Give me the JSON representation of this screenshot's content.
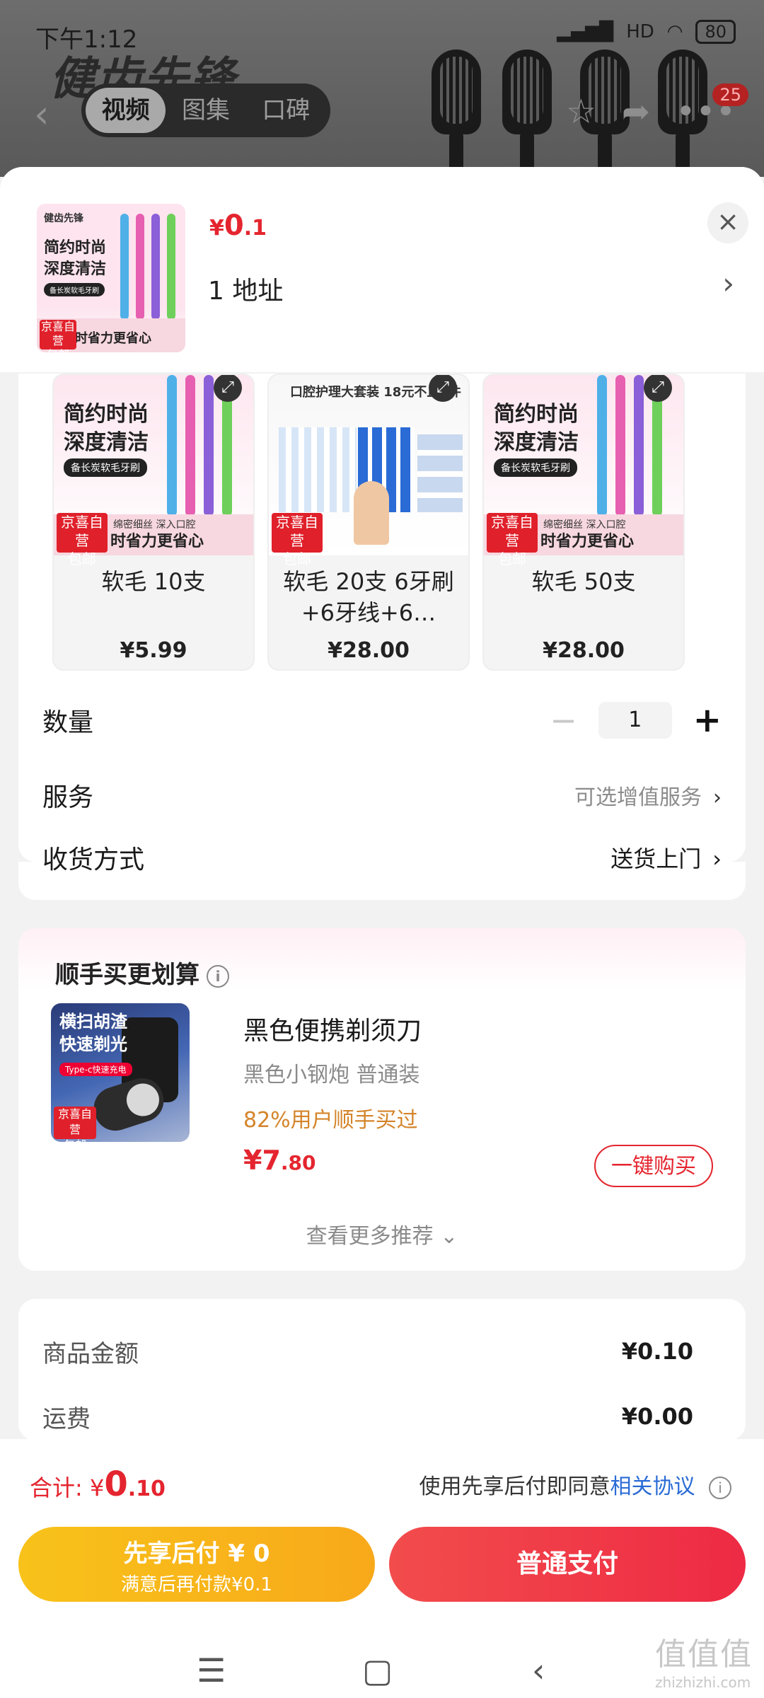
{
  "status_bar": {
    "time": "下午1:12",
    "battery": "80",
    "signal": "HD"
  },
  "top": {
    "brand": "健齿先锋",
    "tabs": [
      {
        "label": "视频",
        "active": true
      },
      {
        "label": "图集",
        "active": false
      },
      {
        "label": "口碑",
        "active": false
      }
    ],
    "cart_count": "25"
  },
  "sheet": {
    "price": {
      "symbol": "¥",
      "int": "0",
      "dec": ".1"
    },
    "address": "1  地址",
    "thumb": {
      "brand": "健齿先锋",
      "line1": "简约时尚",
      "line2": "深度清洁",
      "pill": "备长炭软毛牙刷",
      "badge": "京喜自营",
      "badge2": "包邮",
      "foot_small": "绵密细丝  深入口腔",
      "foot": "时省力更省心"
    }
  },
  "variants": [
    {
      "name": "软毛 10支",
      "price": "¥5.99",
      "line1": "简约时尚",
      "line2": "深度清洁",
      "pill": "备长炭软毛牙刷",
      "foot": "时省力更省心",
      "small": "绵密细丝  深入口腔"
    },
    {
      "name": "软毛 20支 6牙刷+6牙线+6…",
      "price": "¥28.00",
      "top": "口腔护理大套装   18元不止4件"
    },
    {
      "name": "软毛 50支",
      "price": "¥28.00",
      "line1": "简约时尚",
      "line2": "深度清洁",
      "pill": "备长炭软毛牙刷",
      "foot": "时省力更省心",
      "small": "绵密细丝  深入口腔"
    }
  ],
  "rows": {
    "quantity_label": "数量",
    "quantity_value": "1",
    "service_label": "服务",
    "service_value": "可选增值服务",
    "delivery_label": "收货方式",
    "delivery_value": "送货上门"
  },
  "recommend": {
    "title": "顺手买更划算",
    "img_text": "横扫胡渣\n快速剃光",
    "img_small": "Type-c快速充电",
    "name": "黑色便携剃须刀",
    "spec": "黑色小钢炮 普通装",
    "rate": "82%用户顺手买过",
    "price_int": "7",
    "price_dec": ".80",
    "buy": "一键购买",
    "more": "查看更多推荐"
  },
  "summary": [
    {
      "label": "商品金额",
      "value": "¥0.10"
    },
    {
      "label": "运费",
      "value": "¥0.00"
    }
  ],
  "bottom": {
    "total_label": "合计:",
    "total_int": "0",
    "total_dec": ".10",
    "agree_text": "使用先享后付即同意",
    "agree_link": "相关协议",
    "later_l1": "先享后付 ¥ 0",
    "later_l2": "满意后再付款¥0.1",
    "pay": "普通支付"
  },
  "watermark": {
    "big": "值值值",
    "small": "zhizhizhi.com"
  },
  "colors": {
    "accent": "#e4252f",
    "later": "#f8b21a",
    "link": "#2a6bd6",
    "rate": "#d4842a"
  }
}
